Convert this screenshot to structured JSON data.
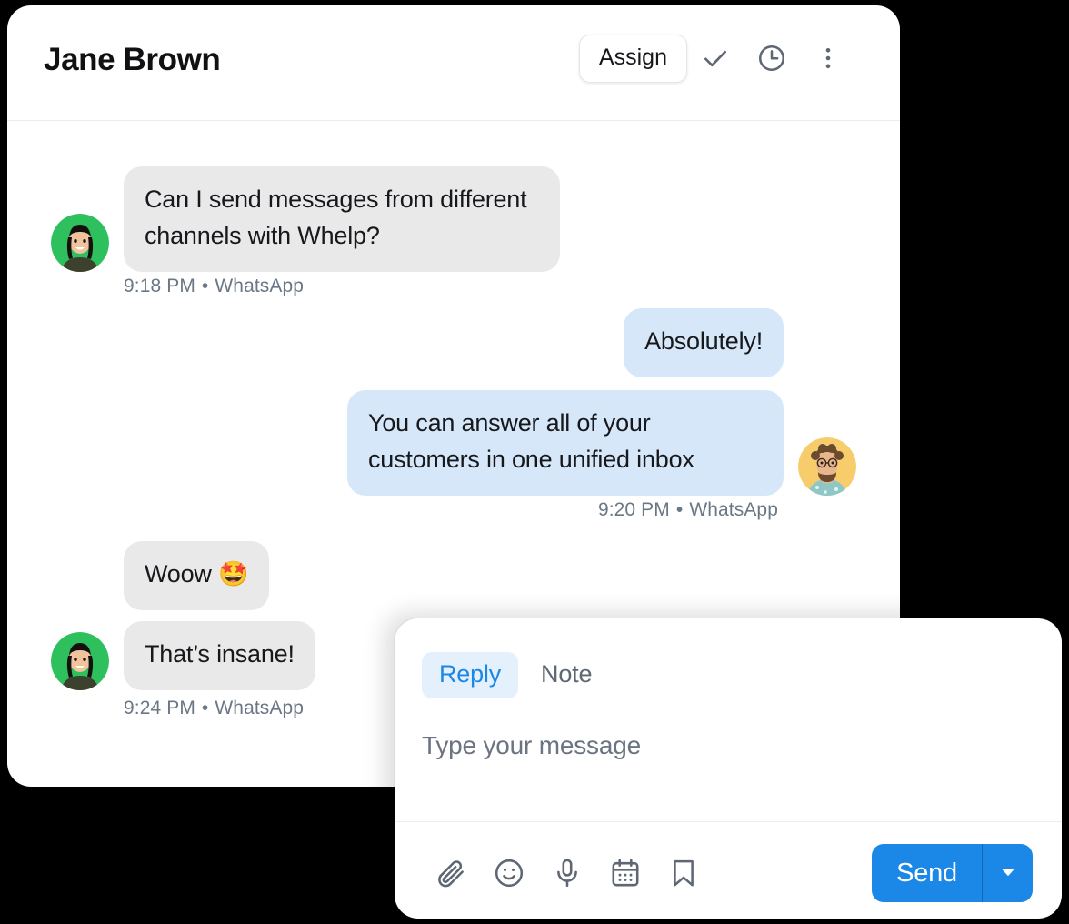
{
  "header": {
    "contact_name": "Jane Brown",
    "assign_label": "Assign",
    "icons": {
      "resolve": "check-icon",
      "snooze": "clock-icon",
      "more": "more-vertical-icon"
    }
  },
  "thread": {
    "messages": [
      {
        "id": "m1",
        "direction": "incoming",
        "text": "Can I send messages from different channels with Whelp?",
        "time": "9:18 PM",
        "separator": "•",
        "channel": "WhatsApp",
        "avatar": "customer-avatar"
      },
      {
        "id": "m2",
        "direction": "outgoing",
        "text": "Absolutely!"
      },
      {
        "id": "m3",
        "direction": "outgoing",
        "text": "You can answer all of your customers in one unified inbox",
        "time": "9:20 PM",
        "separator": "•",
        "channel": "WhatsApp",
        "avatar": "agent-avatar"
      },
      {
        "id": "m4",
        "direction": "incoming",
        "text": "Woow 🤩"
      },
      {
        "id": "m5",
        "direction": "incoming",
        "text": "That’s insane!",
        "time": "9:24 PM",
        "separator": "•",
        "channel": "WhatsApp",
        "avatar": "customer-avatar"
      }
    ]
  },
  "compose": {
    "tabs": [
      {
        "label": "Reply",
        "active": true
      },
      {
        "label": "Note",
        "active": false
      }
    ],
    "placeholder": "Type your message",
    "value": "",
    "toolbar_icons": [
      "attachment-icon",
      "emoji-icon",
      "microphone-icon",
      "calendar-icon",
      "bookmark-icon"
    ],
    "send_label": "Send",
    "send_dropdown_icon": "chevron-down-icon"
  },
  "colors": {
    "page_background": "#000000",
    "card_background": "#ffffff",
    "incoming_bubble": "#e9e9ea",
    "outgoing_bubble": "#d6e7f9",
    "accent_blue": "#1b87e6",
    "tab_active_background": "#e5f0fd",
    "meta_text": "#6b7785",
    "title_text": "#111113"
  }
}
